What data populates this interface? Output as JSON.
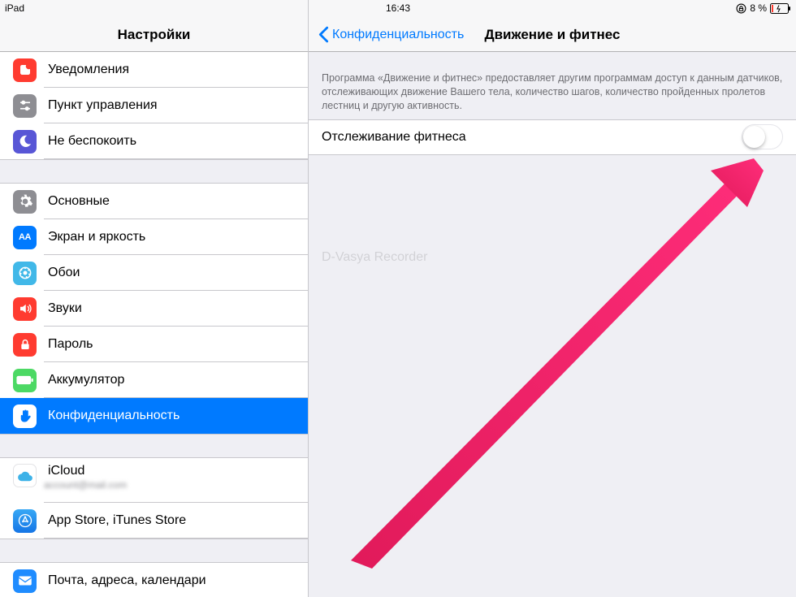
{
  "status": {
    "device": "iPad",
    "time": "16:43",
    "battery_pct": "8 %"
  },
  "sidebar": {
    "title": "Настройки",
    "group1": [
      {
        "label": "Уведомления"
      },
      {
        "label": "Пункт управления"
      },
      {
        "label": "Не беспокоить"
      }
    ],
    "group2": [
      {
        "label": "Основные"
      },
      {
        "label": "Экран и яркость"
      },
      {
        "label": "Обои"
      },
      {
        "label": "Звуки"
      },
      {
        "label": "Пароль"
      },
      {
        "label": "Аккумулятор"
      },
      {
        "label": "Конфиденциальность"
      }
    ],
    "group3": [
      {
        "label": "iCloud"
      },
      {
        "label": "App Store, iTunes Store"
      }
    ],
    "group4": [
      {
        "label": "Почта, адреса, календари"
      }
    ],
    "faded_extra": "D-Vasya Recorder"
  },
  "main": {
    "back_label": "Конфиденциальность",
    "title": "Движение и фитнес",
    "explain": "Программа «Движение и фитнес» предоставляет другим программам доступ к данным датчиков, отслеживающих движение Вашего тела, количество шагов, количество пройденных пролетов лестниц и другую активность.",
    "switch_label": "Отслеживание фитнеса"
  },
  "colors": {
    "red": "#ff3b30",
    "grey": "#8e8e93",
    "moon": "#5856d6",
    "blue": "#007aff",
    "brightblue": "#3091ff",
    "cyan": "#2fb2e0",
    "green": "#4cd964",
    "white_on_blue": "#ffffff"
  }
}
